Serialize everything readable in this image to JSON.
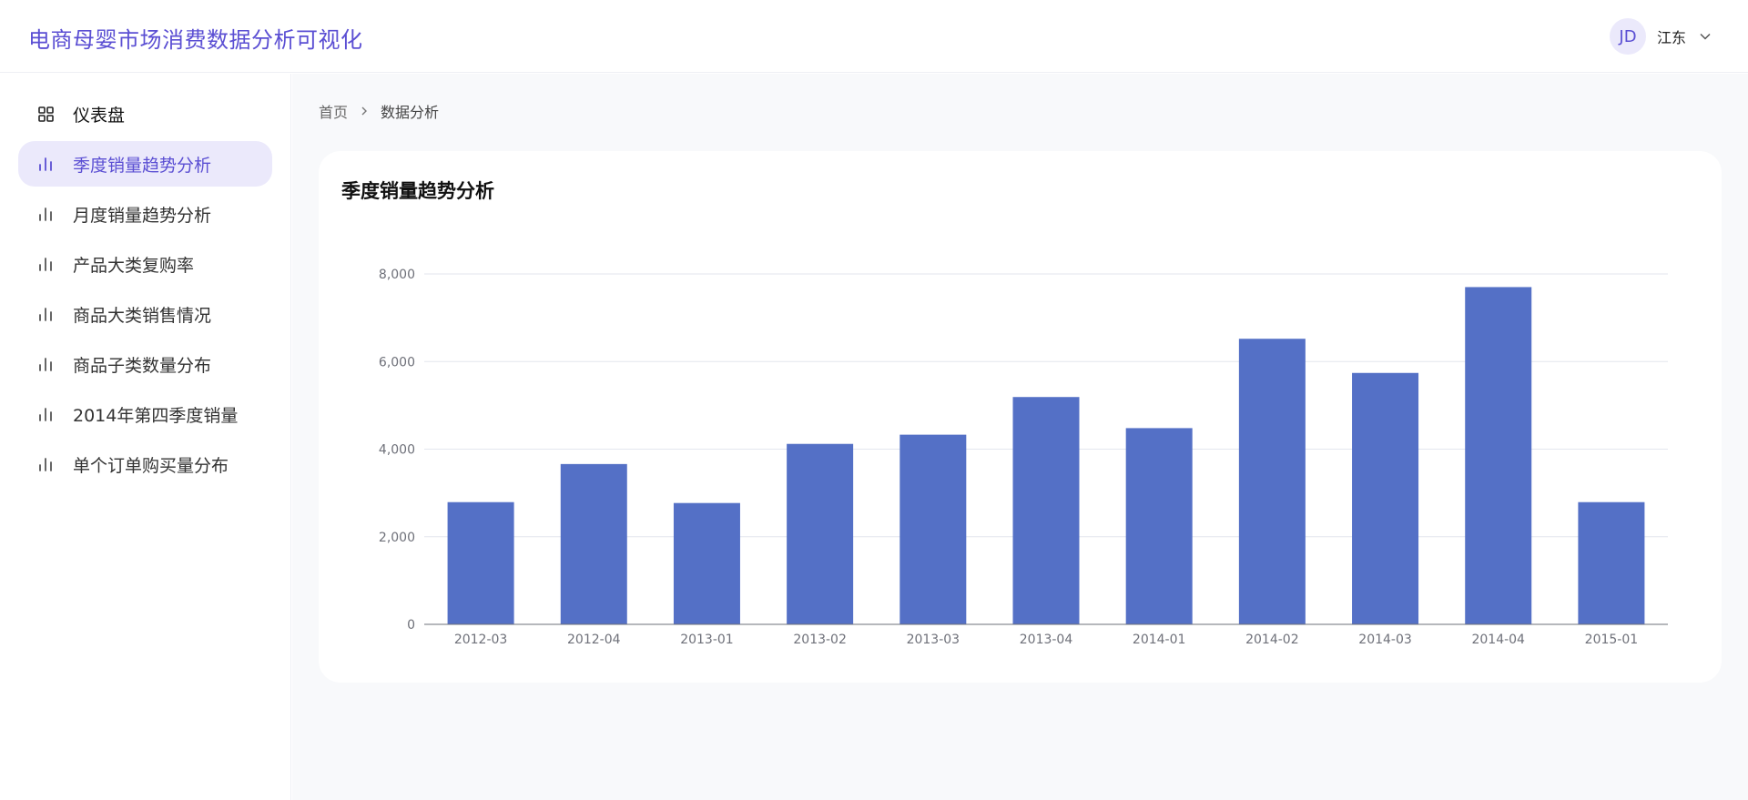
{
  "app": {
    "title": "电商母婴市场消费数据分析可视化"
  },
  "user": {
    "initials": "JD",
    "name": "江东"
  },
  "sidebar": {
    "items": [
      {
        "label": "仪表盘",
        "icon": "dashboard-icon"
      },
      {
        "label": "季度销量趋势分析",
        "icon": "bar-chart-icon",
        "active": true
      },
      {
        "label": "月度销量趋势分析",
        "icon": "bar-chart-icon"
      },
      {
        "label": "产品大类复购率",
        "icon": "bar-chart-icon"
      },
      {
        "label": "商品大类销售情况",
        "icon": "bar-chart-icon"
      },
      {
        "label": "商品子类数量分布",
        "icon": "bar-chart-icon"
      },
      {
        "label": "2014年第四季度销量",
        "icon": "bar-chart-icon"
      },
      {
        "label": "单个订单购买量分布",
        "icon": "bar-chart-icon"
      }
    ]
  },
  "breadcrumb": {
    "home": "首页",
    "current": "数据分析"
  },
  "card": {
    "title": "季度销量趋势分析"
  },
  "colors": {
    "accent": "#5b4fd3",
    "bar": "#5470c6",
    "accent_bg": "#ebe9fb"
  },
  "chart_data": {
    "type": "bar",
    "title": "",
    "xlabel": "",
    "ylabel": "",
    "categories": [
      "2012-03",
      "2012-04",
      "2013-01",
      "2013-02",
      "2013-03",
      "2013-04",
      "2014-01",
      "2014-02",
      "2014-03",
      "2014-04",
      "2015-01"
    ],
    "values": [
      2790,
      3660,
      2770,
      4120,
      4330,
      5190,
      4480,
      6520,
      5740,
      7700,
      2790
    ],
    "ylim": [
      0,
      8000
    ],
    "yticks": [
      0,
      2000,
      4000,
      6000,
      8000
    ],
    "ytick_labels": [
      "0",
      "2,000",
      "4,000",
      "6,000",
      "8,000"
    ],
    "grid": true,
    "legend": "none"
  }
}
